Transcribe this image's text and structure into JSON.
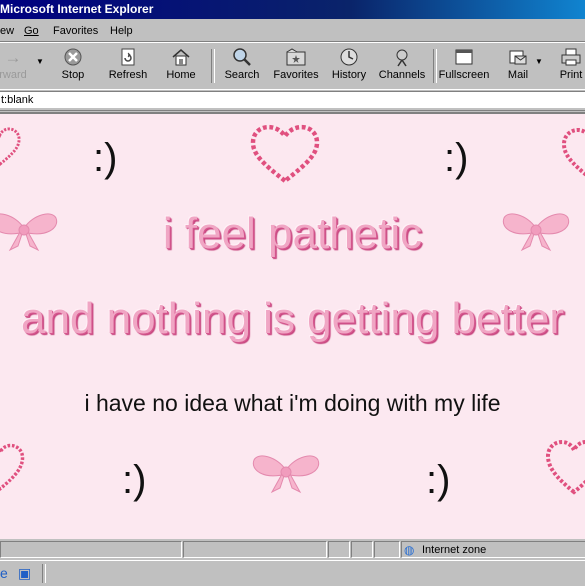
{
  "window": {
    "title": "Microsoft Internet Explorer"
  },
  "menu": {
    "items": [
      {
        "label": "View",
        "visible_label": "ew"
      },
      {
        "label": "Go"
      },
      {
        "label": "Favorites"
      },
      {
        "label": "Help"
      }
    ]
  },
  "toolbar": {
    "buttons": [
      {
        "label": "Forward",
        "visible_label": "rward",
        "icon": "forward-arrow-icon",
        "enabled": false
      },
      {
        "label": "Stop",
        "icon": "stop-icon",
        "enabled": true
      },
      {
        "label": "Refresh",
        "icon": "refresh-icon",
        "enabled": true
      },
      {
        "label": "Home",
        "icon": "home-icon",
        "enabled": true
      },
      {
        "label": "Search",
        "icon": "search-icon",
        "enabled": true
      },
      {
        "label": "Favorites",
        "icon": "favorites-icon",
        "enabled": true
      },
      {
        "label": "History",
        "icon": "history-icon",
        "enabled": true
      },
      {
        "label": "Channels",
        "icon": "channels-icon",
        "enabled": true
      },
      {
        "label": "Fullscreen",
        "icon": "fullscreen-icon",
        "enabled": true
      },
      {
        "label": "Mail",
        "icon": "mail-icon",
        "enabled": true
      },
      {
        "label": "Print",
        "icon": "print-icon",
        "enabled": true
      }
    ]
  },
  "address": {
    "value": "about:blank",
    "visible_value": "t:blank"
  },
  "page": {
    "smiley": ":)",
    "line1": "i feel pathetic",
    "line2": "and nothing is getting better",
    "line3": "i have no idea what i'm doing with my life",
    "colors": {
      "background": "#fce8f0",
      "glitter_pink": "#f0a6c4",
      "heart_outline": "#e0507f",
      "bow": "#f6b4cc"
    }
  },
  "status": {
    "zone": "Internet zone"
  }
}
